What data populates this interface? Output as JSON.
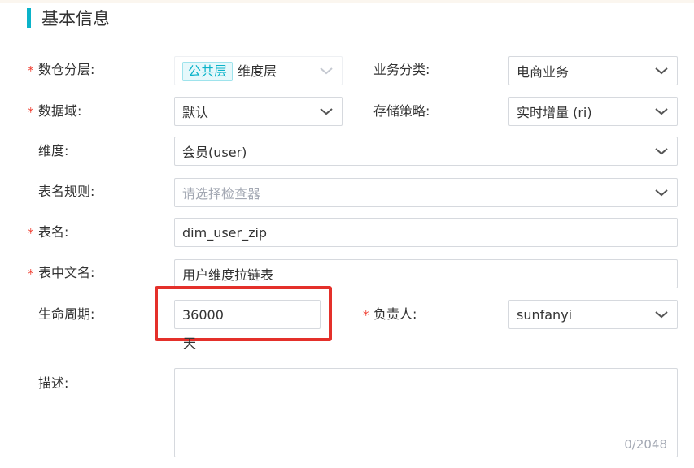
{
  "section": {
    "title": "基本信息"
  },
  "form": {
    "warehouse_layer": {
      "label": "数仓分层:",
      "required": "*",
      "tag": "公共层",
      "value": "维度层"
    },
    "business_category": {
      "label": "业务分类:",
      "value": "电商业务"
    },
    "data_domain": {
      "label": "数据域:",
      "required": "*",
      "value": "默认"
    },
    "storage_strategy": {
      "label": "存储策略:",
      "value": "实时增量 (ri)"
    },
    "dimension": {
      "label": "维度:",
      "value": "会员(user)"
    },
    "table_name_rule": {
      "label": "表名规则:",
      "placeholder": "请选择检查器"
    },
    "table_name": {
      "label": "表名:",
      "required": "*",
      "value": "dim_user_zip"
    },
    "table_cn_name": {
      "label": "表中文名:",
      "required": "*",
      "value": "用户维度拉链表"
    },
    "lifecycle": {
      "label": "生命周期:",
      "value": "36000",
      "unit": "天"
    },
    "owner": {
      "label": "负责人:",
      "required": "*",
      "value": "sunfanyi"
    },
    "description": {
      "label": "描述:",
      "counter": "0/2048"
    }
  },
  "icons": {
    "dropdown": "chevron-down-icon"
  },
  "colors": {
    "accent": "#0bb3c9",
    "required": "#f04134",
    "highlight": "#e4302a",
    "placeholder": "#a3a8b3"
  }
}
